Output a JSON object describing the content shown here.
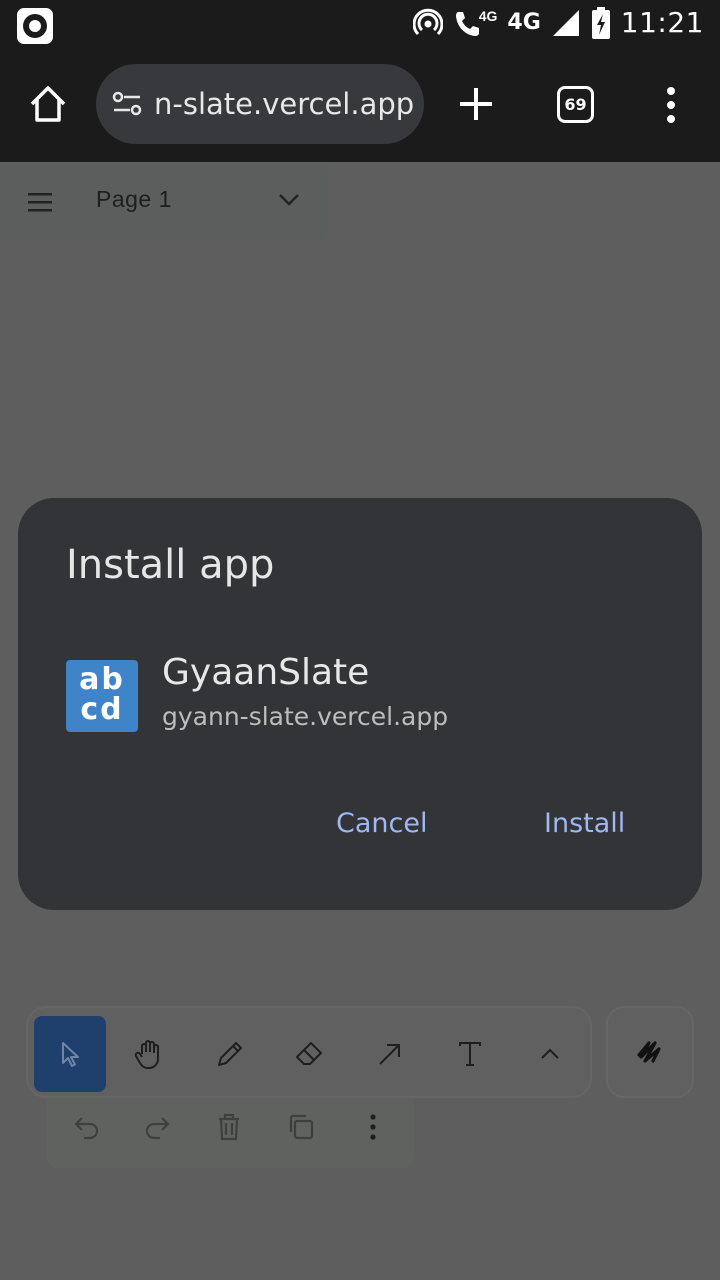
{
  "status_bar": {
    "network_small": "4G",
    "network": "4G",
    "time": "11:21"
  },
  "browser": {
    "url": "n-slate.vercel.app",
    "tab_count": "69"
  },
  "page": {
    "page_name": "Page 1"
  },
  "dialog": {
    "title": "Install app",
    "app_icon_text_top": "ab",
    "app_icon_text_bottom": "cd",
    "app_name": "GyaanSlate",
    "app_url": "gyann-slate.vercel.app",
    "cancel_label": "Cancel",
    "install_label": "Install",
    "accent_color": "#9fb8ef"
  },
  "tools": [
    "select-icon",
    "hand-icon",
    "pencil-icon",
    "eraser-icon",
    "arrow-icon",
    "text-icon",
    "chevron-up-icon"
  ],
  "edit_actions": [
    "undo-icon",
    "redo-icon",
    "trash-icon",
    "duplicate-icon",
    "more-vert-icon"
  ]
}
